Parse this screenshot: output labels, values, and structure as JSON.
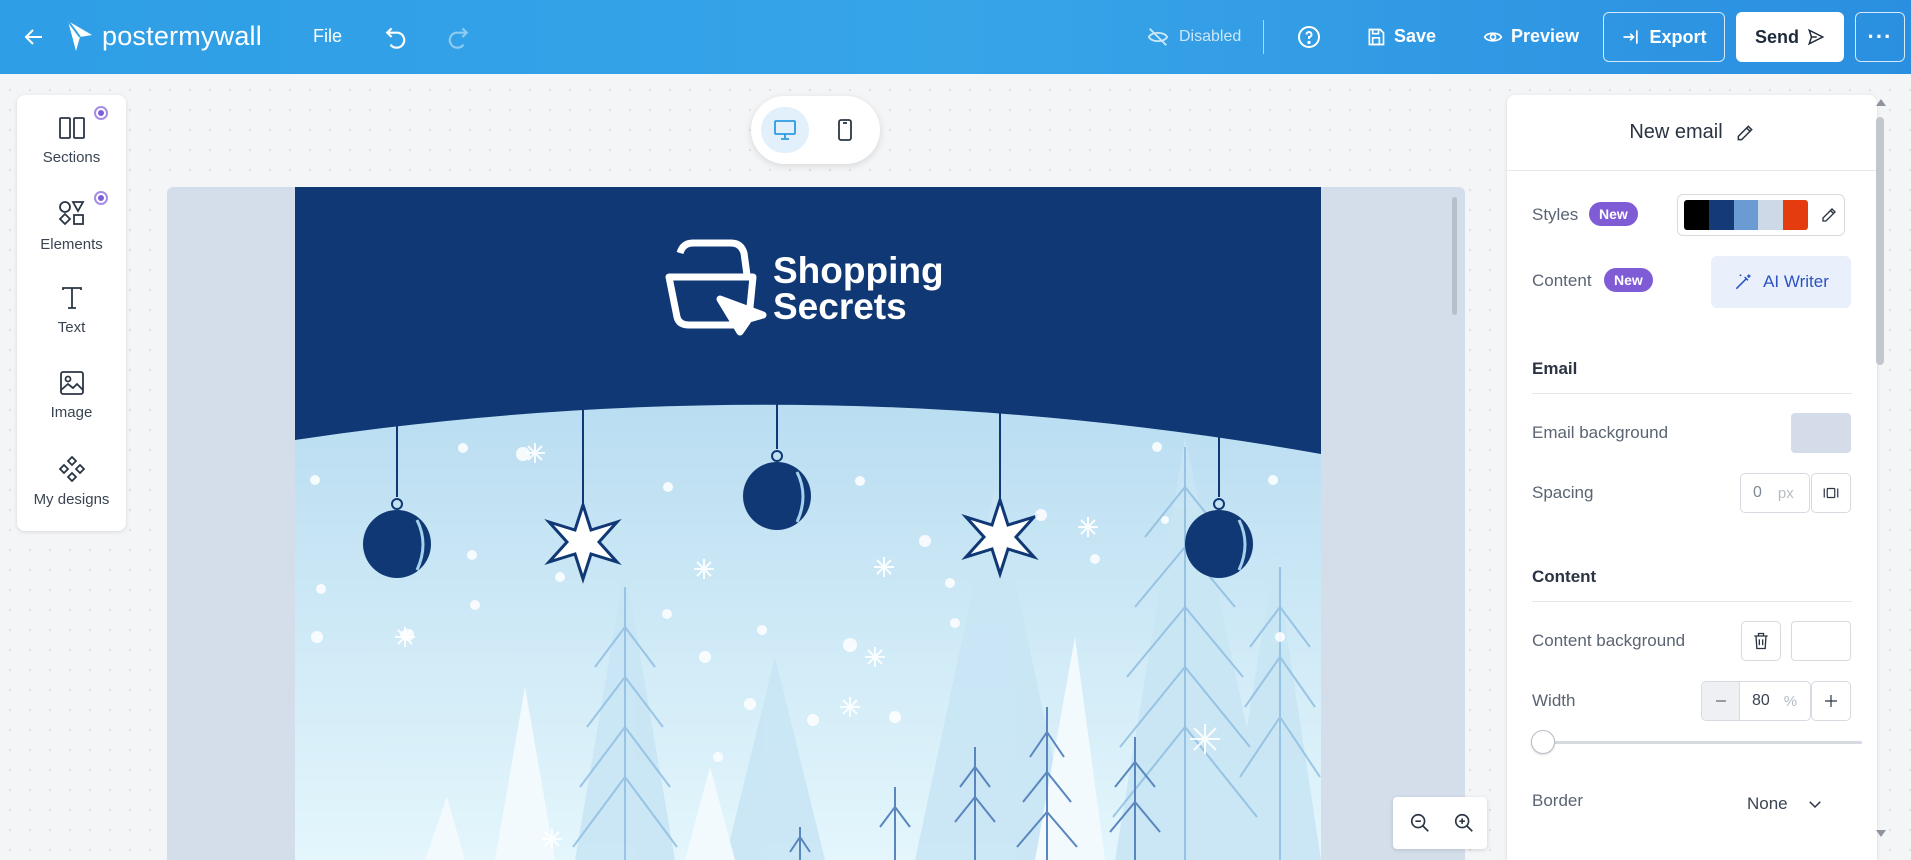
{
  "header": {
    "logo_text": "postermywall",
    "file_label": "File",
    "status_label": "Disabled",
    "save_label": "Save",
    "preview_label": "Preview",
    "export_label": "Export",
    "send_label": "Send",
    "more_label": "···"
  },
  "left_toolbar": {
    "items": [
      {
        "label": "Sections",
        "icon": "sections-icon",
        "has_dot": true
      },
      {
        "label": "Elements",
        "icon": "elements-icon",
        "has_dot": true
      },
      {
        "label": "Text",
        "icon": "text-icon",
        "has_dot": false
      },
      {
        "label": "Image",
        "icon": "image-icon",
        "has_dot": false
      },
      {
        "label": "My designs",
        "icon": "my-designs-icon",
        "has_dot": false
      }
    ]
  },
  "device_toggle": {
    "selected": "desktop",
    "options": [
      "desktop",
      "mobile"
    ]
  },
  "email": {
    "brand_line1": "Shopping",
    "brand_line2": "Secrets",
    "header_color": "#0f3875",
    "sky_top": "#a5d1ec",
    "sky_bottom": "#e4f6fc"
  },
  "panel": {
    "title": "New email",
    "styles_label": "Styles",
    "styles_badge": "New",
    "swatches": [
      "#000000",
      "#143a77",
      "#6b9bd3",
      "#ced9e8",
      "#e43b0f"
    ],
    "content_label": "Content",
    "content_badge": "New",
    "ai_writer_label": "AI Writer",
    "email_section": "Email",
    "email_background_label": "Email background",
    "email_background_color": "#d3dce8",
    "spacing_label": "Spacing",
    "spacing_value": "0",
    "spacing_unit": "px",
    "content_section": "Content",
    "content_background_label": "Content background",
    "content_background_color": "#ffffff",
    "width_label": "Width",
    "width_value": "80",
    "width_unit": "%",
    "border_label": "Border",
    "border_value": "None"
  },
  "colors": {
    "header_gradient": "#2e9ee6",
    "accent": "#2c9ae4",
    "badge": "#7f5bd6"
  }
}
